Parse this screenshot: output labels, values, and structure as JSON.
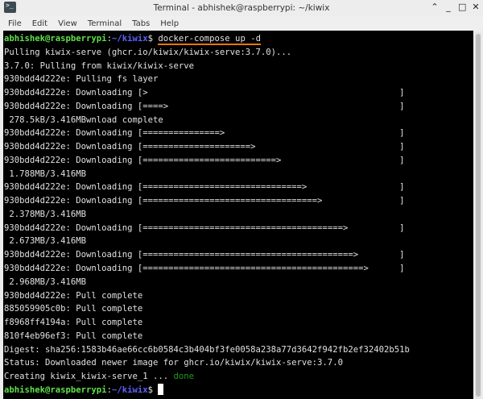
{
  "window": {
    "title": "Terminal - abhishek@raspberrypi: ~/kiwix",
    "icon": "terminal-icon"
  },
  "menu": [
    "File",
    "Edit",
    "View",
    "Terminal",
    "Tabs",
    "Help"
  ],
  "prompt": {
    "user": "abhishek@raspberrypi",
    "sep": ":",
    "path": "~/kiwix",
    "symbol": "$"
  },
  "colors": {
    "user": "#5fe04a",
    "path": "#6060ff",
    "done": "#1e9a1e",
    "underline": "#e8750f"
  },
  "lines": [
    {
      "type": "prompt",
      "cmd": "docker-compose up -d"
    },
    {
      "text": "Pulling kiwix-serve (ghcr.io/kiwix/kiwix-serve:3.7.0)..."
    },
    {
      "text": "3.7.0: Pulling from kiwix/kiwix-serve"
    },
    {
      "text": "930bdd4d222e: Pulling fs layer"
    },
    {
      "text": "930bdd4d222e: Downloading ",
      "progress": 0
    },
    {
      "text": "930bdd4d222e: Downloading ",
      "progress": 4
    },
    {
      "text": " 278.5kB/3.416MBwnload complete"
    },
    {
      "text": "930bdd4d222e: Downloading ",
      "progress": 15
    },
    {
      "text": "930bdd4d222e: Downloading ",
      "progress": 21
    },
    {
      "text": "930bdd4d222e: Downloading ",
      "progress": 26
    },
    {
      "text": " 1.788MB/3.416MB"
    },
    {
      "text": "930bdd4d222e: Downloading ",
      "progress": 31
    },
    {
      "text": "930bdd4d222e: Downloading ",
      "progress": 34
    },
    {
      "text": " 2.378MB/3.416MB"
    },
    {
      "text": "930bdd4d222e: Downloading ",
      "progress": 39
    },
    {
      "text": " 2.673MB/3.416MB"
    },
    {
      "text": "930bdd4d222e: Downloading ",
      "progress": 41
    },
    {
      "text": "930bdd4d222e: Downloading ",
      "progress": 43
    },
    {
      "text": " 2.968MB/3.416MB"
    },
    {
      "text": "930bdd4d222e: Pull complete"
    },
    {
      "text": "885059905c0b: Pull complete"
    },
    {
      "text": "f8968ff4194a: Pull complete"
    },
    {
      "text": "810f4eb96ef3: Pull complete"
    },
    {
      "text": "Digest: sha256:1583b46ae66cc6b0584c3b404bf3fe0058a238a77d3642f942fb2ef32402b51b"
    },
    {
      "text": "Status: Downloaded newer image for ghcr.io/kiwix/kiwix-serve:3.7.0"
    },
    {
      "text": "Creating kiwix_kiwix-serve_1 ... ",
      "status": "done"
    },
    {
      "type": "prompt",
      "cmd": "",
      "cursor": true
    }
  ]
}
